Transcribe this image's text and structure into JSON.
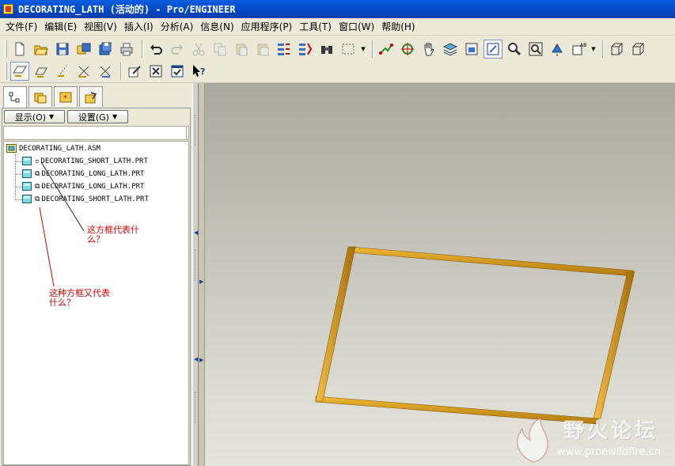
{
  "window": {
    "title": "DECORATING_LATH (活动的) - Pro/ENGINEER"
  },
  "menu": [
    "文件(F)",
    "编辑(E)",
    "视图(V)",
    "插入(I)",
    "分析(A)",
    "信息(N)",
    "应用程序(P)",
    "工具(T)",
    "窗口(W)",
    "帮助(H)"
  ],
  "model_tree": {
    "show_button": "显示(O)",
    "settings_button": "设置(G)",
    "root": "DECORATING_LATH.ASM",
    "items": [
      "DECORATING_SHORT_LATH.PRT",
      "DECORATING_LONG_LATH.PRT",
      "DECORATING_LONG_LATH.PRT",
      "DECORATING_SHORT_LATH.PRT"
    ]
  },
  "annotations": {
    "a1_line1": "这方框代表什",
    "a1_line2": "么？",
    "a2_line1": "这种方框又代表",
    "a2_line2": "什么？"
  },
  "watermark": {
    "title": "野火论坛",
    "url": "www.proewildfire.cn"
  },
  "colors": {
    "lath": "#e2a21c",
    "lath_dark": "#9b6a08",
    "annotation": "#d40000"
  }
}
